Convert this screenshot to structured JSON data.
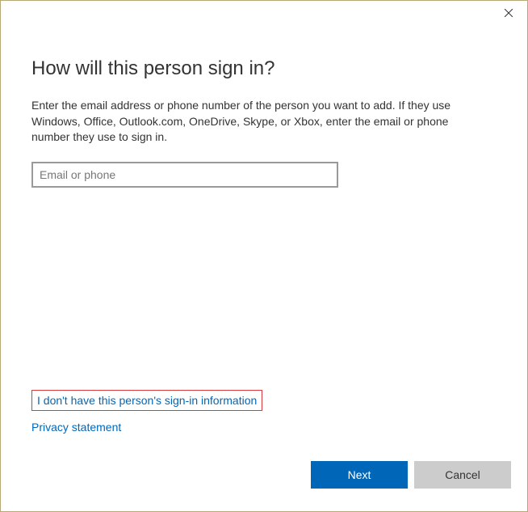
{
  "dialog": {
    "heading": "How will this person sign in?",
    "description": "Enter the email address or phone number of the person you want to add. If they use Windows, Office, Outlook.com, OneDrive, Skype, or Xbox, enter the email or phone number they use to sign in.",
    "input": {
      "placeholder": "Email or phone",
      "value": ""
    },
    "links": {
      "no_signin_info": "I don't have this person's sign-in information",
      "privacy": "Privacy statement"
    },
    "buttons": {
      "next": "Next",
      "cancel": "Cancel"
    }
  }
}
